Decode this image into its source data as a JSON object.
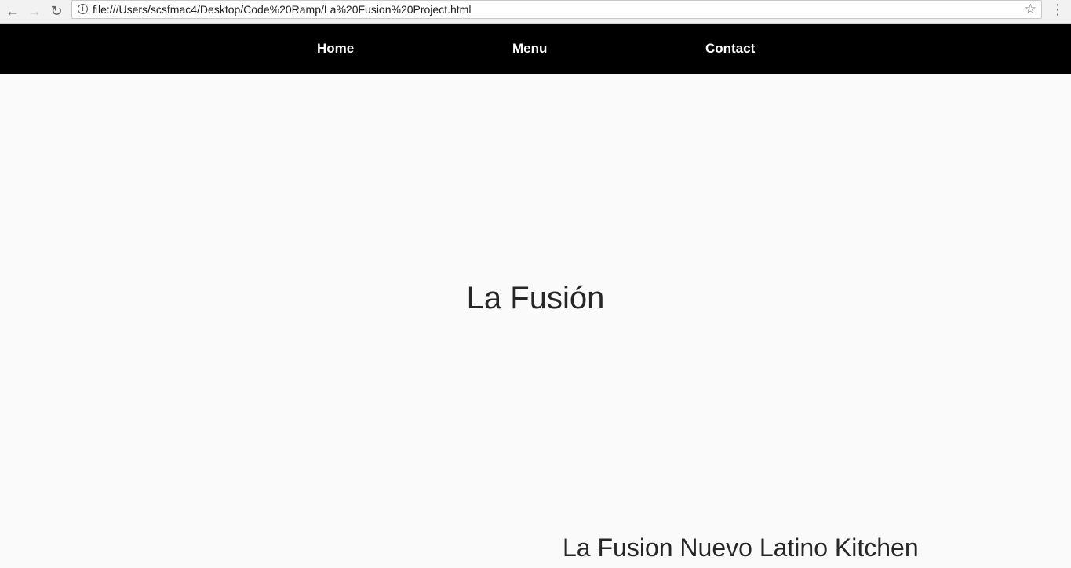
{
  "browser": {
    "back_icon": "←",
    "forward_icon": "→",
    "reload_icon": "↻",
    "url": "file:///Users/scsfmac4/Desktop/Code%20Ramp/La%20Fusion%20Project.html",
    "info_icon": "i",
    "star_icon": "☆",
    "menu_icon": "⋮"
  },
  "nav": {
    "home": "Home",
    "menu": "Menu",
    "contact": "Contact"
  },
  "hero": {
    "title": "La Fusión"
  },
  "section": {
    "heading": "La Fusion Nuevo Latino Kitchen"
  },
  "colors": {
    "nav_background": "#000000",
    "nav_text": "#ffffff",
    "page_background": "#fafafa",
    "heading_text": "#262626"
  }
}
